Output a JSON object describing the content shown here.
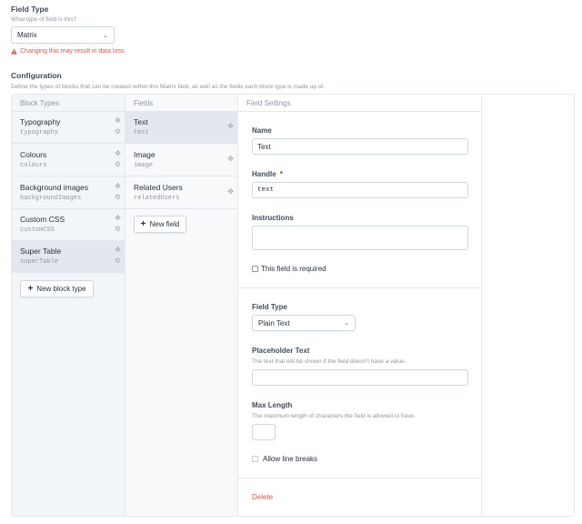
{
  "field_type": {
    "label": "Field Type",
    "hint": "What type of field is this?",
    "selected": "Matrix",
    "warning": "Changing this may result in data loss."
  },
  "configuration": {
    "label": "Configuration",
    "hint": "Define the types of blocks that can be created within this Matrix field, as well as the fields each block type is made up of.",
    "block_types_header": "Block Types",
    "fields_header": "Fields",
    "settings_header": "Field Settings",
    "block_types": [
      {
        "name": "Typography",
        "handle": "typography"
      },
      {
        "name": "Colours",
        "handle": "colours"
      },
      {
        "name": "Background images",
        "handle": "backgroundImages"
      },
      {
        "name": "Custom CSS",
        "handle": "customCSS"
      },
      {
        "name": "Super Table",
        "handle": "superTable"
      }
    ],
    "new_block_type_label": "New block type",
    "fields": [
      {
        "name": "Text",
        "handle": "text"
      },
      {
        "name": "Image",
        "handle": "image"
      },
      {
        "name": "Related Users",
        "handle": "relatedUsers"
      }
    ],
    "new_field_label": "New field"
  },
  "settings": {
    "name_label": "Name",
    "name_value": "Text",
    "handle_label": "Handle",
    "handle_value": "text",
    "instructions_label": "Instructions",
    "required_label": "This field is required",
    "field_type_label": "Field Type",
    "field_type_value": "Plain Text",
    "placeholder_label": "Placeholder Text",
    "placeholder_hint": "The text that will be shown if the field doesn’t have a value.",
    "max_length_label": "Max Length",
    "max_length_hint": "The maximum length of characters the field is allowed to have.",
    "line_breaks_label": "Allow line breaks",
    "delete_label": "Delete"
  },
  "icons": {
    "warning": "warning-icon",
    "move": "move-icon",
    "gear": "gear-icon",
    "plus": "plus-icon",
    "chevron": "chevron-down-icon"
  },
  "colors": {
    "warning": "#da5a47",
    "selected_row": "#e2e8ee"
  }
}
